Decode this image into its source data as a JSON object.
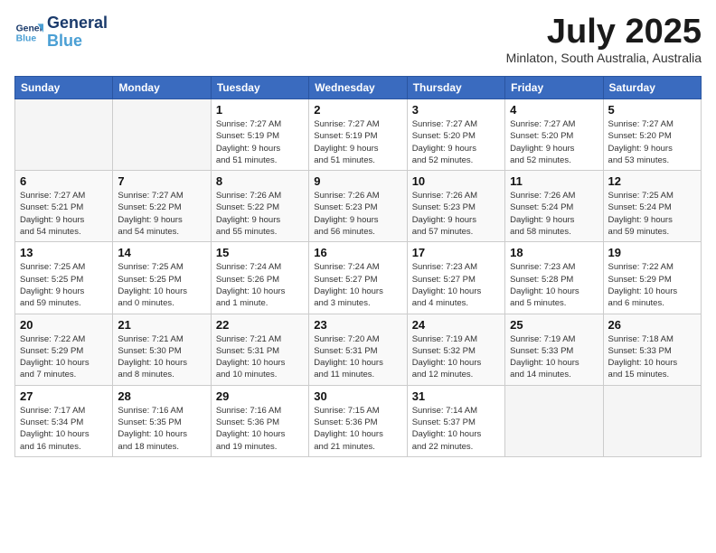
{
  "header": {
    "logo_line1": "General",
    "logo_line2": "Blue",
    "month": "July 2025",
    "location": "Minlaton, South Australia, Australia"
  },
  "days_of_week": [
    "Sunday",
    "Monday",
    "Tuesday",
    "Wednesday",
    "Thursday",
    "Friday",
    "Saturday"
  ],
  "weeks": [
    [
      {
        "day": "",
        "info": ""
      },
      {
        "day": "",
        "info": ""
      },
      {
        "day": "1",
        "info": "Sunrise: 7:27 AM\nSunset: 5:19 PM\nDaylight: 9 hours\nand 51 minutes."
      },
      {
        "day": "2",
        "info": "Sunrise: 7:27 AM\nSunset: 5:19 PM\nDaylight: 9 hours\nand 51 minutes."
      },
      {
        "day": "3",
        "info": "Sunrise: 7:27 AM\nSunset: 5:20 PM\nDaylight: 9 hours\nand 52 minutes."
      },
      {
        "day": "4",
        "info": "Sunrise: 7:27 AM\nSunset: 5:20 PM\nDaylight: 9 hours\nand 52 minutes."
      },
      {
        "day": "5",
        "info": "Sunrise: 7:27 AM\nSunset: 5:20 PM\nDaylight: 9 hours\nand 53 minutes."
      }
    ],
    [
      {
        "day": "6",
        "info": "Sunrise: 7:27 AM\nSunset: 5:21 PM\nDaylight: 9 hours\nand 54 minutes."
      },
      {
        "day": "7",
        "info": "Sunrise: 7:27 AM\nSunset: 5:22 PM\nDaylight: 9 hours\nand 54 minutes."
      },
      {
        "day": "8",
        "info": "Sunrise: 7:26 AM\nSunset: 5:22 PM\nDaylight: 9 hours\nand 55 minutes."
      },
      {
        "day": "9",
        "info": "Sunrise: 7:26 AM\nSunset: 5:23 PM\nDaylight: 9 hours\nand 56 minutes."
      },
      {
        "day": "10",
        "info": "Sunrise: 7:26 AM\nSunset: 5:23 PM\nDaylight: 9 hours\nand 57 minutes."
      },
      {
        "day": "11",
        "info": "Sunrise: 7:26 AM\nSunset: 5:24 PM\nDaylight: 9 hours\nand 58 minutes."
      },
      {
        "day": "12",
        "info": "Sunrise: 7:25 AM\nSunset: 5:24 PM\nDaylight: 9 hours\nand 59 minutes."
      }
    ],
    [
      {
        "day": "13",
        "info": "Sunrise: 7:25 AM\nSunset: 5:25 PM\nDaylight: 9 hours\nand 59 minutes."
      },
      {
        "day": "14",
        "info": "Sunrise: 7:25 AM\nSunset: 5:25 PM\nDaylight: 10 hours\nand 0 minutes."
      },
      {
        "day": "15",
        "info": "Sunrise: 7:24 AM\nSunset: 5:26 PM\nDaylight: 10 hours\nand 1 minute."
      },
      {
        "day": "16",
        "info": "Sunrise: 7:24 AM\nSunset: 5:27 PM\nDaylight: 10 hours\nand 3 minutes."
      },
      {
        "day": "17",
        "info": "Sunrise: 7:23 AM\nSunset: 5:27 PM\nDaylight: 10 hours\nand 4 minutes."
      },
      {
        "day": "18",
        "info": "Sunrise: 7:23 AM\nSunset: 5:28 PM\nDaylight: 10 hours\nand 5 minutes."
      },
      {
        "day": "19",
        "info": "Sunrise: 7:22 AM\nSunset: 5:29 PM\nDaylight: 10 hours\nand 6 minutes."
      }
    ],
    [
      {
        "day": "20",
        "info": "Sunrise: 7:22 AM\nSunset: 5:29 PM\nDaylight: 10 hours\nand 7 minutes."
      },
      {
        "day": "21",
        "info": "Sunrise: 7:21 AM\nSunset: 5:30 PM\nDaylight: 10 hours\nand 8 minutes."
      },
      {
        "day": "22",
        "info": "Sunrise: 7:21 AM\nSunset: 5:31 PM\nDaylight: 10 hours\nand 10 minutes."
      },
      {
        "day": "23",
        "info": "Sunrise: 7:20 AM\nSunset: 5:31 PM\nDaylight: 10 hours\nand 11 minutes."
      },
      {
        "day": "24",
        "info": "Sunrise: 7:19 AM\nSunset: 5:32 PM\nDaylight: 10 hours\nand 12 minutes."
      },
      {
        "day": "25",
        "info": "Sunrise: 7:19 AM\nSunset: 5:33 PM\nDaylight: 10 hours\nand 14 minutes."
      },
      {
        "day": "26",
        "info": "Sunrise: 7:18 AM\nSunset: 5:33 PM\nDaylight: 10 hours\nand 15 minutes."
      }
    ],
    [
      {
        "day": "27",
        "info": "Sunrise: 7:17 AM\nSunset: 5:34 PM\nDaylight: 10 hours\nand 16 minutes."
      },
      {
        "day": "28",
        "info": "Sunrise: 7:16 AM\nSunset: 5:35 PM\nDaylight: 10 hours\nand 18 minutes."
      },
      {
        "day": "29",
        "info": "Sunrise: 7:16 AM\nSunset: 5:36 PM\nDaylight: 10 hours\nand 19 minutes."
      },
      {
        "day": "30",
        "info": "Sunrise: 7:15 AM\nSunset: 5:36 PM\nDaylight: 10 hours\nand 21 minutes."
      },
      {
        "day": "31",
        "info": "Sunrise: 7:14 AM\nSunset: 5:37 PM\nDaylight: 10 hours\nand 22 minutes."
      },
      {
        "day": "",
        "info": ""
      },
      {
        "day": "",
        "info": ""
      }
    ]
  ]
}
